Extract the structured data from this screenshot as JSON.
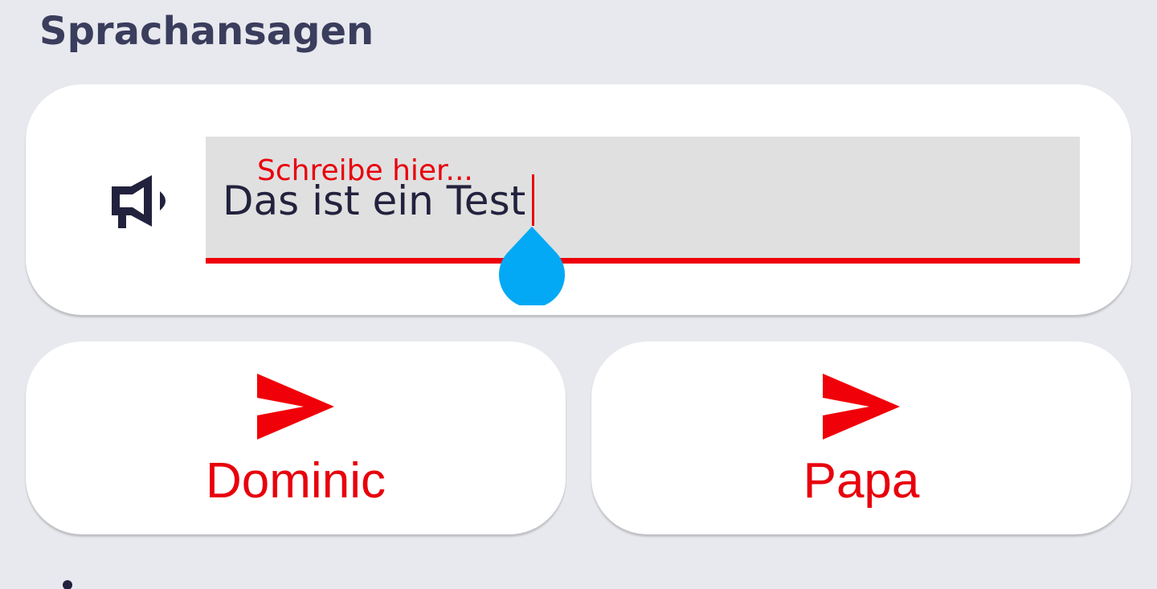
{
  "section": {
    "title": "Sprachansagen"
  },
  "announce": {
    "icon": "megaphone-icon",
    "input_label": "Schreibe hier...",
    "input_value": "Das ist ein Test"
  },
  "send_buttons": [
    {
      "icon": "send-icon",
      "label": "Dominic"
    },
    {
      "icon": "send-icon",
      "label": "Papa"
    }
  ],
  "colors": {
    "background": "#e8e9ee",
    "card": "#ffffff",
    "title": "#3a3d5c",
    "accent_red": "#e8000c",
    "input_fill": "#e0e0e0",
    "input_text": "#22223e",
    "handle_blue": "#03a9f4"
  }
}
